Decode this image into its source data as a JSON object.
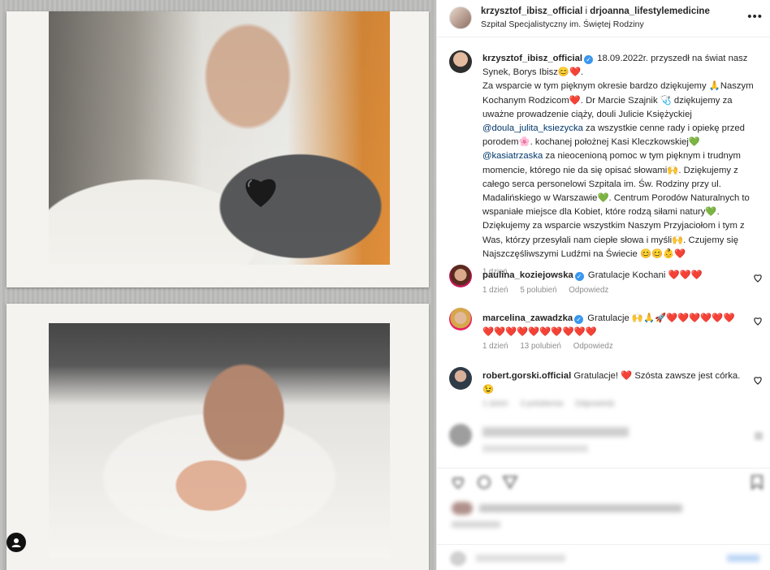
{
  "post": {
    "header": {
      "user1": "krzysztof_ibisz_official",
      "and": " i ",
      "user2": "drjoanna_lifestylemedicine",
      "location": "Szpital Specjalistyczny im. Świętej Rodziny",
      "more": "•••"
    },
    "caption": {
      "username": "krzysztof_ibisz_official",
      "segments": [
        "18.09.2022r. przyszedł na świat nasz Synek, Borys Ibisz😊❤️.",
        "Za wsparcie w tym pięknym okresie bardzo dziękujemy 🙏Naszym Kochanym Rodzicom❤️. Dr Marcie Szajnik 🩺 dziękujemy za uważne prowadzenie ciąży, douli Julicie Księżyckiej",
        "@doula_julita_ksiezycka",
        " za wszystkie cenne rady i opiekę przed porodem🌸. kochanej położnej Kasi Kleczkowskiej💚",
        "@kasiatrzaska",
        " za nieocenioną pomoc w tym pięknym i trudnym momencie, którego nie da się opisać słowami🙌. Dziękujemy z całego serca personelowi Szpitala im. Św. Rodziny przy ul. Madalińskiego w Warszawie💚. Centrum Porodów Naturalnych to wspaniałe miejsce dla Kobiet, które rodzą siłami natury💚. Dziękujemy za wsparcie wszystkim Naszym Przyjaciołom i tym z Was, którzy przesyłali nam ciepłe słowa i myśli🙌. Czujemy się Najszczęśliwszymi Ludźmi na Świecie 😊😊👶❤️"
      ],
      "time": "1 dzień"
    },
    "comments": [
      {
        "username": "paulina_koziejowska",
        "text": "Gratulacje Kochani ❤️❤️❤️",
        "time": "1 dzień",
        "likes": "5 polubień",
        "reply": "Odpowiedz"
      },
      {
        "username": "marcelina_zawadzka",
        "text": "Gratulacje 🙌🙏🚀❤️❤️❤️❤️❤️❤️❤️❤️❤️❤️❤️❤️❤️❤️❤️❤️",
        "time": "1 dzień",
        "likes": "13 polubień",
        "reply": "Odpowiedz"
      },
      {
        "username": "robert.gorski.official",
        "text": "Gratulacje! ❤️ Szósta zawsze jest córka. 😉",
        "time": "1 dzień",
        "likes": "3 polubienia",
        "reply": "Odpowiedz"
      }
    ]
  }
}
